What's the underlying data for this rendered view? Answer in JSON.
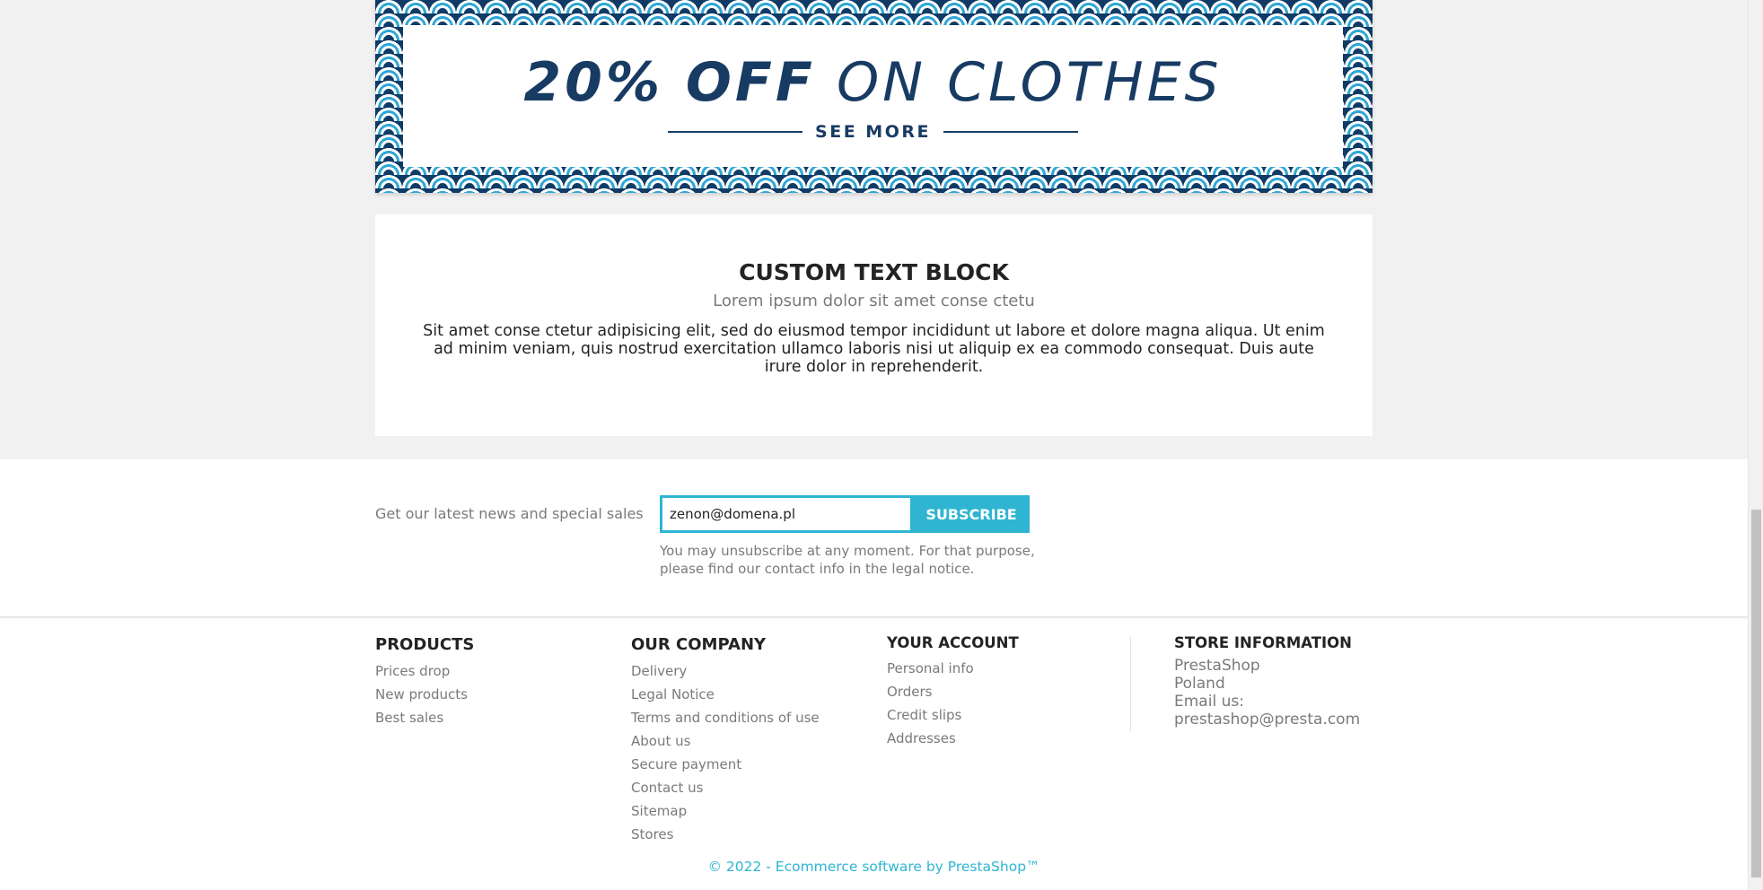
{
  "banner": {
    "title_bold": "20% OFF",
    "title_rest": "ON CLOTHES",
    "see_more": "SEE MORE"
  },
  "custom_text_block": {
    "title": "CUSTOM TEXT BLOCK",
    "subtitle": "Lorem ipsum dolor sit amet conse ctetu",
    "body": "Sit amet conse ctetur adipisicing elit, sed do eiusmod tempor incididunt ut labore et dolore magna aliqua. Ut enim ad minim veniam, quis nostrud exercitation ullamco laboris nisi ut aliquip ex ea commodo consequat. Duis aute irure dolor in reprehenderit."
  },
  "newsletter": {
    "label": "Get our latest news and special sales",
    "email_value": "zenon@domena.pl",
    "subscribe_label": "SUBSCRIBE",
    "note": "You may unsubscribe at any moment. For that purpose, please find our contact info in the legal notice."
  },
  "footer": {
    "products": {
      "title": "PRODUCTS",
      "links": [
        "Prices drop",
        "New products",
        "Best sales"
      ]
    },
    "company": {
      "title": "OUR COMPANY",
      "links": [
        "Delivery",
        "Legal Notice",
        "Terms and conditions of use",
        "About us",
        "Secure payment",
        "Contact us",
        "Sitemap",
        "Stores"
      ]
    },
    "account": {
      "title": "YOUR ACCOUNT",
      "links": [
        "Personal info",
        "Orders",
        "Credit slips",
        "Addresses"
      ]
    },
    "store": {
      "title": "STORE INFORMATION",
      "lines": [
        "PrestaShop",
        "Poland",
        "Email us:",
        "prestashop@presta.com"
      ]
    },
    "copyright": "© 2022 - Ecommerce software by PrestaShop™"
  },
  "colors": {
    "accent": "#2fb5d2",
    "banner_navy": "#183b63",
    "text_dark": "#232323",
    "text_muted": "#7a7a7a"
  }
}
